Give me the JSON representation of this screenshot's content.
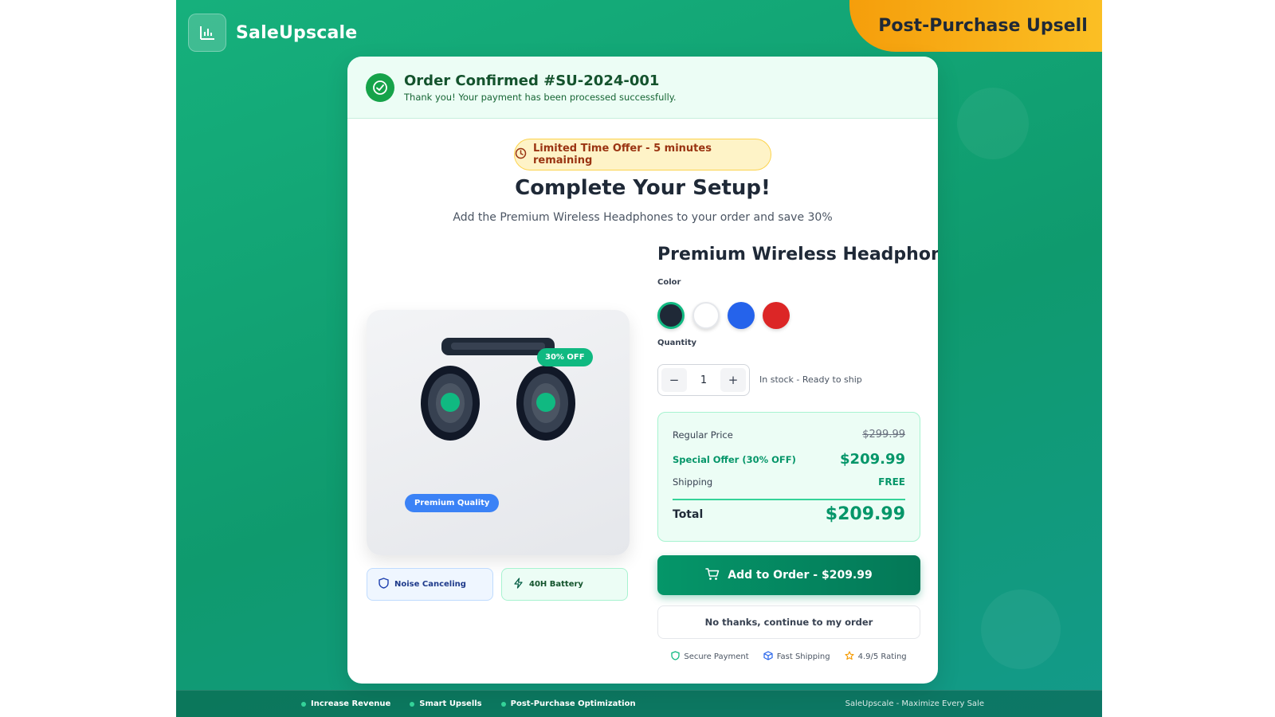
{
  "brand": {
    "name": "SaleUpscale",
    "icon": "bar-chart-icon"
  },
  "corner_tag": {
    "label": "Post-Purchase Upsell"
  },
  "confirmation": {
    "title": "Order Confirmed #SU-2024-001",
    "subtitle": "Thank you! Your payment has been processed successfully.",
    "icon": "check-circle-icon"
  },
  "offer": {
    "timer_text": "Limited Time Offer - 5 minutes remaining",
    "headline": "Complete Your Setup!",
    "subline": "Add the Premium Wireless Headphones to your order and save 30%"
  },
  "product": {
    "title": "Premium Wireless Headphones",
    "discount_badge": "30% OFF",
    "quality_badge": "Premium Quality",
    "features": [
      {
        "label": "Noise Canceling",
        "icon": "shield-icon"
      },
      {
        "label": "40H Battery",
        "icon": "lightning-icon"
      }
    ],
    "color_label": "Color",
    "colors": [
      "#1f2937",
      "#ffffff",
      "#2563eb",
      "#dc2626"
    ],
    "quantity_label": "Quantity",
    "quantity": "1",
    "decrement_symbol": "−",
    "increment_symbol": "+",
    "stock_status": "In stock - Ready to ship"
  },
  "pricing": {
    "regular_label": "Regular Price",
    "regular_value": "$299.99",
    "special_label": "Special Offer (30% OFF)",
    "special_value": "$209.99",
    "shipping_label": "Shipping",
    "shipping_value": "FREE",
    "total_label": "Total",
    "total_value": "$209.99"
  },
  "actions": {
    "add_label": "Add to Order - $209.99",
    "decline_label": "No thanks, continue to my order"
  },
  "trust": [
    {
      "label": "Secure Payment",
      "icon": "shield-icon"
    },
    {
      "label": "Fast Shipping",
      "icon": "box-icon"
    },
    {
      "label": "4.9/5 Rating",
      "icon": "star-icon"
    }
  ],
  "footer": {
    "items": [
      "Increase Revenue",
      "Smart Upsells",
      "Post-Purchase Optimization"
    ],
    "tagline": "SaleUpscale - Maximize Every Sale"
  },
  "colors": {
    "primary": "#059669",
    "accent": "#f59e0b",
    "confirm_bg": "#ecfdf5",
    "info_blue": "#3b82f6"
  }
}
